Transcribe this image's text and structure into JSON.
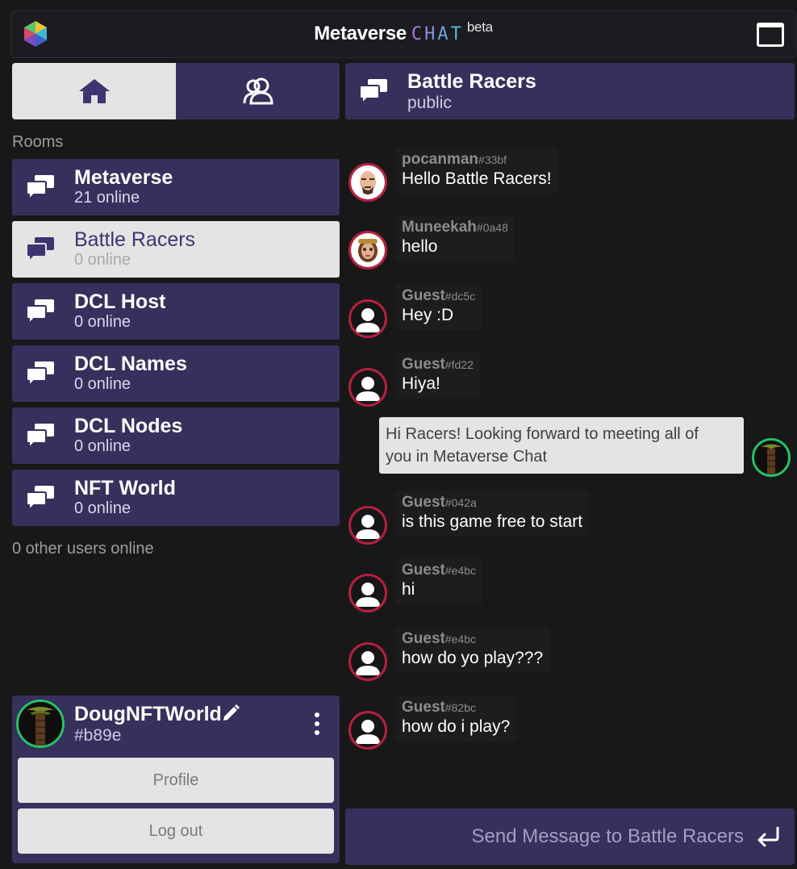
{
  "header": {
    "title_main": "Metaverse",
    "title_chat": "CHAT",
    "title_beta": "beta",
    "logo_icon": "hexagon-cube-logo-icon",
    "fullscreen_icon": "window-maximize-icon"
  },
  "left_tabs": [
    {
      "icon": "home-icon",
      "active": true
    },
    {
      "icon": "users-icon",
      "active": false
    }
  ],
  "rooms_label": "Rooms",
  "rooms": [
    {
      "name": "Metaverse",
      "count": "21 online",
      "active": false
    },
    {
      "name": "Battle Racers",
      "count": "0 online",
      "active": true
    },
    {
      "name": "DCL Host",
      "count": "0 online",
      "active": false
    },
    {
      "name": "DCL Names",
      "count": "0 online",
      "active": false
    },
    {
      "name": "DCL Nodes",
      "count": "0 online",
      "active": false
    },
    {
      "name": "NFT World",
      "count": "0 online",
      "active": false
    }
  ],
  "other_users_text": "0 other users online",
  "profile": {
    "name": "DougNFTWorld",
    "tag": "#b89e",
    "profile_button": "Profile",
    "logout_button": "Log out"
  },
  "channel": {
    "name": "Battle Racers",
    "visibility": "public"
  },
  "messages": [
    {
      "user": "pocanman",
      "hash": "#33bf",
      "text": "Hello Battle Racers!",
      "avatar": "bald-man-avatar"
    },
    {
      "user": "Muneekah",
      "hash": "#0a48",
      "text": "hello",
      "avatar": "woman-avatar"
    },
    {
      "user": "Guest",
      "hash": "#dc5c",
      "text": "Hey :D",
      "avatar": "default-user-avatar"
    },
    {
      "user": "Guest",
      "hash": "#fd22",
      "text": "Hiya!",
      "avatar": "default-user-avatar"
    },
    {
      "user": "Guest",
      "hash": "#042a",
      "text": "is this game free to start",
      "avatar": "default-user-avatar"
    },
    {
      "user": "Guest",
      "hash": "#e4bc",
      "text": "hi",
      "avatar": "default-user-avatar"
    },
    {
      "user": "Guest",
      "hash": "#e4bc",
      "text": "how do yo play???",
      "avatar": "default-user-avatar"
    },
    {
      "user": "Guest",
      "hash": "#82bc",
      "text": "how do i play?",
      "avatar": "default-user-avatar"
    }
  ],
  "my_message": {
    "line1": "Hi Racers! Looking forward to meeting all of",
    "line2": "you in Metaverse Chat"
  },
  "send": {
    "placeholder": "Send Message to Battle Racers",
    "icon": "enter-return-icon"
  },
  "colors": {
    "background": "#181818",
    "panel": "#37305c",
    "active": "#e4e4e4",
    "avatar_ring_others": "#b5213f",
    "avatar_ring_me": "#24c466"
  }
}
